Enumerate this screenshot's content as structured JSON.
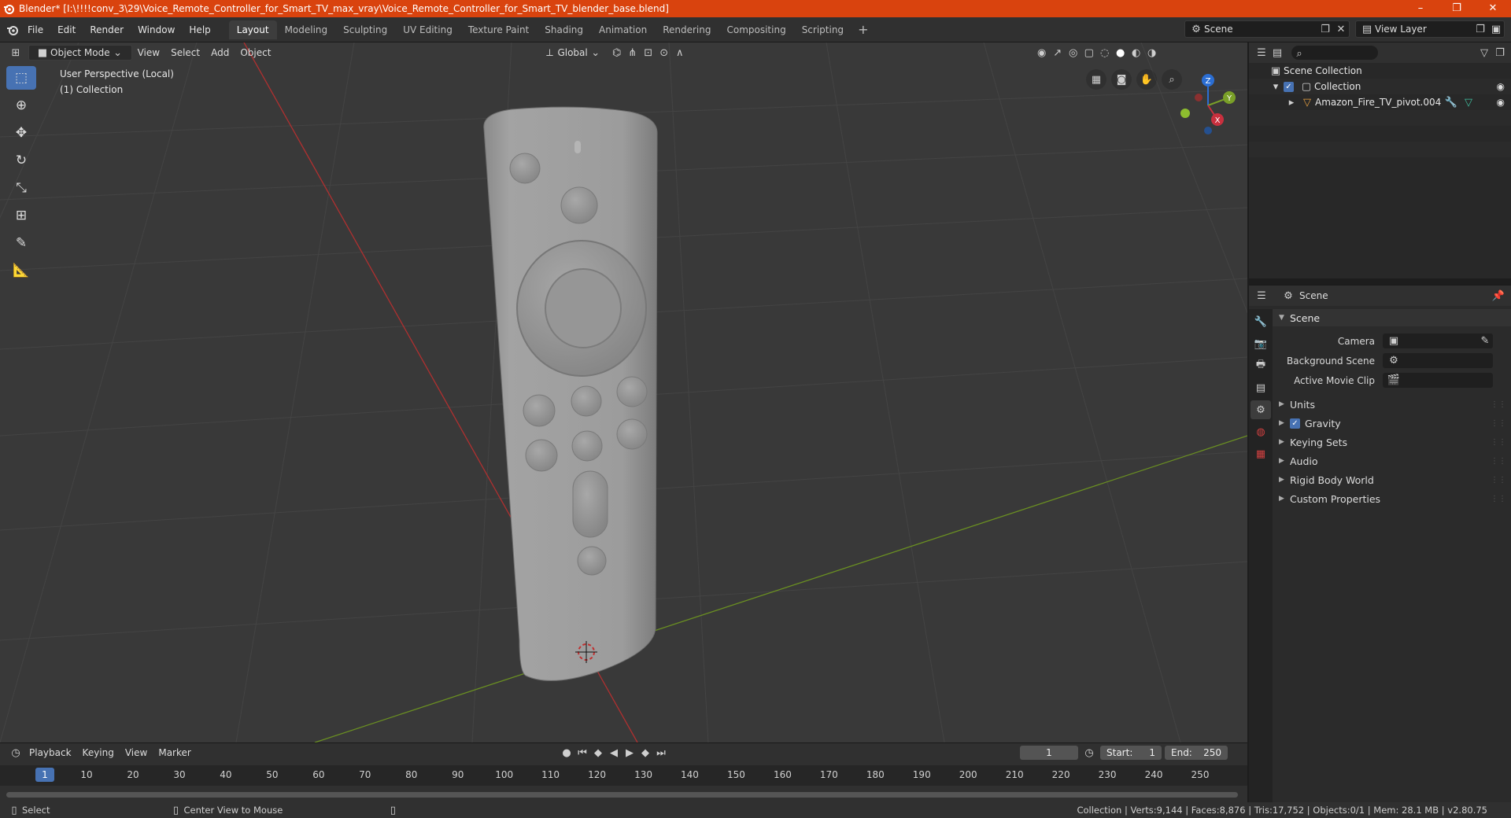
{
  "window": {
    "title": "Blender* [I:\\!!!!conv_3\\29\\Voice_Remote_Controller_for_Smart_TV_max_vray\\Voice_Remote_Controller_for_Smart_TV_blender_base.blend]",
    "minimize": "–",
    "maximize": "❐",
    "close": "✕"
  },
  "menu": {
    "items": [
      "File",
      "Edit",
      "Render",
      "Window",
      "Help"
    ]
  },
  "workspaces": [
    "Layout",
    "Modeling",
    "Sculpting",
    "UV Editing",
    "Texture Paint",
    "Shading",
    "Animation",
    "Rendering",
    "Compositing",
    "Scripting"
  ],
  "workspace_add": "+",
  "scene_selector": "Scene",
  "view_layer_selector": "View Layer",
  "viewport": {
    "mode": "Object Mode",
    "menus": [
      "View",
      "Select",
      "Add",
      "Object"
    ],
    "orientation": "Global",
    "info_line1": "User Perspective (Local)",
    "info_line2": "(1) Collection",
    "gizmo_axes": {
      "z": "Z",
      "y": "Y",
      "x": "X"
    }
  },
  "timeline": {
    "menus": [
      "Playback",
      "Keying",
      "View",
      "Marker"
    ],
    "current_frame": "1",
    "start_label": "Start:",
    "start": "1",
    "end_label": "End:",
    "end": "250",
    "ruler": [
      "1",
      "10",
      "20",
      "30",
      "40",
      "50",
      "60",
      "70",
      "80",
      "90",
      "100",
      "110",
      "120",
      "130",
      "140",
      "150",
      "160",
      "170",
      "180",
      "190",
      "200",
      "210",
      "220",
      "230",
      "240",
      "250"
    ]
  },
  "status": {
    "left_action": "Select",
    "mid_action": "Center View to Mouse",
    "stats": "Collection | Verts:9,144 | Faces:8,876 | Tris:17,752 | Objects:0/1 | Mem: 28.1 MB | v2.80.75"
  },
  "outliner": {
    "rows": [
      {
        "label": "Scene Collection"
      },
      {
        "label": "Collection"
      },
      {
        "label": "Amazon_Fire_TV_pivot.004"
      }
    ]
  },
  "properties": {
    "header": "Scene",
    "panel": "Scene",
    "fields": [
      {
        "label": "Camera"
      },
      {
        "label": "Background Scene"
      },
      {
        "label": "Active Movie Clip"
      }
    ],
    "subpanels": [
      "Units",
      "Gravity",
      "Keying Sets",
      "Audio",
      "Rigid Body World",
      "Custom Properties"
    ]
  },
  "colors": {
    "titlebar": "#d9430e",
    "accent": "#4772b3",
    "x_axis": "#c9303e",
    "y_axis": "#7aa028"
  }
}
